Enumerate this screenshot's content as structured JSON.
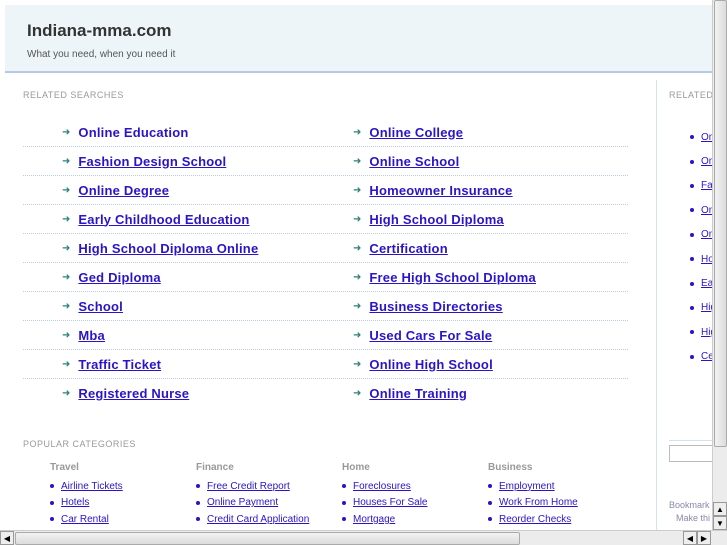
{
  "header": {
    "title": "Indiana-mma.com",
    "tagline": "What you need, when you need it"
  },
  "related": {
    "label": "RELATED SEARCHES",
    "rows": [
      [
        "Online Education",
        "Online College"
      ],
      [
        "Fashion Design School",
        "Online School"
      ],
      [
        "Online Degree",
        "Homeowner Insurance"
      ],
      [
        "Early Childhood Education",
        "High School Diploma"
      ],
      [
        "High School Diploma Online",
        "Certification"
      ],
      [
        "Ged Diploma",
        "Free High School Diploma"
      ],
      [
        "School",
        "Business Directories"
      ],
      [
        "Mba",
        "Used Cars For Sale"
      ],
      [
        "Traffic Ticket",
        "Online High School"
      ],
      [
        "Registered Nurse",
        "Online Training"
      ]
    ]
  },
  "popular": {
    "label": "POPULAR CATEGORIES",
    "categories": [
      {
        "name": "Travel",
        "items": [
          "Airline Tickets",
          "Hotels",
          "Car Rental"
        ]
      },
      {
        "name": "Finance",
        "items": [
          "Free Credit Report",
          "Online Payment",
          "Credit Card Application"
        ]
      },
      {
        "name": "Home",
        "items": [
          "Foreclosures",
          "Houses For Sale",
          "Mortgage"
        ]
      },
      {
        "name": "Business",
        "items": [
          "Employment",
          "Work From Home",
          "Reorder Checks"
        ]
      }
    ]
  },
  "sidebar": {
    "label": "RELATED",
    "items": [
      "Om",
      "Om",
      "Fa",
      "Om",
      "Om",
      "Ho",
      "Ea",
      "Hig",
      "Hig",
      "Ce"
    ],
    "bookmark": "Bookmark",
    "make": "Make thi"
  },
  "colors": {
    "link": "#2a14c8",
    "arrow": "#2a7f78",
    "header_bg": "#eef5f8"
  }
}
